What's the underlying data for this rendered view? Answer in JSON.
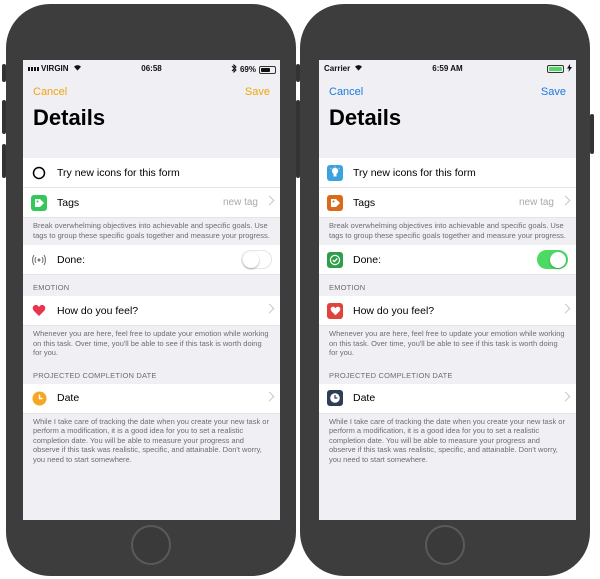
{
  "phones": [
    {
      "status": {
        "carrier": "VIRGIN",
        "time": "06:58",
        "battery": "69%"
      },
      "nav": {
        "cancel": "Cancel",
        "save": "Save",
        "title": "Details"
      },
      "accent": "#f0a50a",
      "row_try": {
        "label": "Try new icons for this form",
        "icon": "circle-outline-icon"
      },
      "row_tags": {
        "label": "Tags",
        "detail": "new tag",
        "icon": "tag-icon"
      },
      "tags_note": "Break overwhelming objectives into achievable and specific goals. Use tags to group these specific goals together and measure your progress.",
      "row_done": {
        "label": "Done:",
        "toggle": "off",
        "icon": "broadcast-icon"
      },
      "emotion_header": "EMOTION",
      "row_feel": {
        "label": "How do you feel?",
        "icon": "heart-icon"
      },
      "feel_note": "Whenever you are here, feel free to update your emotion while working on this task. Over time, you'll be able to see if this task is worth doing for you.",
      "date_header": "PROJECTED COMPLETION DATE",
      "row_date": {
        "label": "Date",
        "icon": "clock-icon"
      },
      "date_note": "While I take care of tracking the date when you create your new task or perform a modification, it is a good idea for you to set a realistic completion date. You will be able to measure your progress and observe if this task was realistic, specific, and attainable. Don't worry, you need to start somewhere."
    },
    {
      "status": {
        "carrier": "Carrier",
        "time": "6:59 AM",
        "battery": ""
      },
      "nav": {
        "cancel": "Cancel",
        "save": "Save",
        "title": "Details"
      },
      "accent": "#1a7ae0",
      "row_try": {
        "label": "Try new icons for this form",
        "icon": "lightbulb-icon"
      },
      "row_tags": {
        "label": "Tags",
        "detail": "new tag",
        "icon": "tag-icon"
      },
      "tags_note": "Break overwhelming objectives into achievable and specific goals. Use tags to group these specific goals together and measure your progress.",
      "row_done": {
        "label": "Done:",
        "toggle": "on",
        "icon": "checkmark-icon"
      },
      "emotion_header": "EMOTION",
      "row_feel": {
        "label": "How do you feel?",
        "icon": "heart-icon"
      },
      "feel_note": "Whenever you are here, feel free to update your emotion while working on this task. Over time, you'll be able to see if this task is worth doing for you.",
      "date_header": "PROJECTED COMPLETION DATE",
      "row_date": {
        "label": "Date",
        "icon": "clock-icon"
      },
      "date_note": "While I take care of tracking the date when you create your new task or perform a modification, it is a good idea for you to set a realistic completion date. You will be able to measure your progress and observe if this task was realistic, specific, and attainable. Don't worry, you need to start somewhere."
    }
  ]
}
